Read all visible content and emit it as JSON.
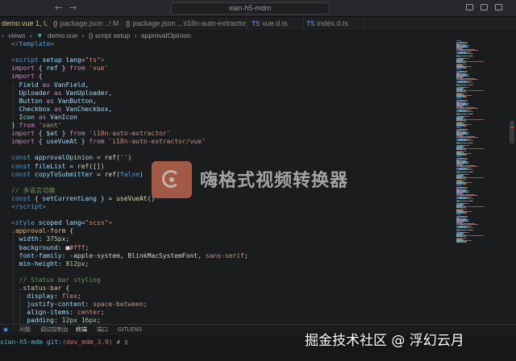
{
  "window": {
    "search_text": "xian-h5-mdm",
    "nav_back": "←",
    "nav_forward": "→"
  },
  "tabs": [
    {
      "label": "demo.vue 1, U",
      "icon": "vue-icon",
      "active": true
    },
    {
      "label": "package.json ../ M",
      "icon": "json-icon",
      "active": false
    },
    {
      "label": "package.json ...\\i18n-auto-extractor",
      "icon": "json-icon",
      "active": false
    },
    {
      "label": "vue.d.ts",
      "icon": "ts-icon",
      "active": false
    },
    {
      "label": "index.d.ts",
      "icon": "ts-icon",
      "active": false
    }
  ],
  "breadcrumb": {
    "items": [
      "views",
      "demo.vue",
      "{} script setup",
      "approvalOpinion"
    ]
  },
  "code_lines": [
    [
      [
        "tk-tag",
        "</"
      ],
      [
        "tk-tagname",
        "template"
      ],
      [
        "tk-tag",
        ">"
      ]
    ],
    [],
    [
      [
        "tk-tag",
        "<"
      ],
      [
        "tk-tagname",
        "script"
      ],
      [
        "tk-attr",
        " setup lang"
      ],
      [
        "tk-plain",
        "="
      ],
      [
        "tk-str",
        "\"ts\""
      ],
      [
        "tk-tag",
        ">"
      ]
    ],
    [
      [
        "tk-kw",
        "import"
      ],
      [
        "tk-plain",
        " { "
      ],
      [
        "tk-var",
        "ref"
      ],
      [
        "tk-plain",
        " } "
      ],
      [
        "tk-kw",
        "from"
      ],
      [
        "tk-str",
        " 'vue'"
      ]
    ],
    [
      [
        "tk-kw",
        "import"
      ],
      [
        "tk-plain",
        " {"
      ]
    ],
    [
      [
        "tk-var",
        "  Field"
      ],
      [
        "tk-kw",
        " as"
      ],
      [
        "tk-var",
        " VanField"
      ],
      [
        "tk-plain",
        ","
      ]
    ],
    [
      [
        "tk-var",
        "  Uploader"
      ],
      [
        "tk-kw",
        " as"
      ],
      [
        "tk-var",
        " VanUploader"
      ],
      [
        "tk-plain",
        ","
      ]
    ],
    [
      [
        "tk-var",
        "  Button"
      ],
      [
        "tk-kw",
        " as"
      ],
      [
        "tk-var",
        " VanButton"
      ],
      [
        "tk-plain",
        ","
      ]
    ],
    [
      [
        "tk-var",
        "  Checkbox"
      ],
      [
        "tk-kw",
        " as"
      ],
      [
        "tk-var",
        " VanCheckbox"
      ],
      [
        "tk-plain",
        ","
      ]
    ],
    [
      [
        "tk-var",
        "  Icon"
      ],
      [
        "tk-kw",
        " as"
      ],
      [
        "tk-var",
        " VanIcon"
      ]
    ],
    [
      [
        "tk-plain",
        "} "
      ],
      [
        "tk-kw",
        "from"
      ],
      [
        "tk-str",
        " 'vant'"
      ]
    ],
    [
      [
        "tk-kw",
        "import"
      ],
      [
        "tk-plain",
        " { "
      ],
      [
        "tk-var",
        "$at"
      ],
      [
        "tk-plain",
        " } "
      ],
      [
        "tk-kw",
        "from"
      ],
      [
        "tk-str",
        " 'i18n-auto-extractor'"
      ]
    ],
    [
      [
        "tk-kw",
        "import"
      ],
      [
        "tk-plain",
        " { "
      ],
      [
        "tk-var",
        "useVueAt"
      ],
      [
        "tk-plain",
        " } "
      ],
      [
        "tk-kw",
        "from"
      ],
      [
        "tk-str",
        " 'i18n-auto-extractor/vue'"
      ]
    ],
    [],
    [
      [
        "tk-kw2",
        "const"
      ],
      [
        "tk-var",
        " approvalOpinion"
      ],
      [
        "tk-plain",
        " = "
      ],
      [
        "tk-fn",
        "ref"
      ],
      [
        "tk-plain",
        "("
      ],
      [
        "tk-str",
        "''"
      ],
      [
        "tk-plain",
        ")"
      ]
    ],
    [
      [
        "tk-kw2",
        "const"
      ],
      [
        "tk-var",
        " fileList"
      ],
      [
        "tk-plain",
        " = "
      ],
      [
        "tk-fn",
        "ref"
      ],
      [
        "tk-plain",
        "([])"
      ]
    ],
    [
      [
        "tk-kw2",
        "const"
      ],
      [
        "tk-var",
        " copyToSubmitter"
      ],
      [
        "tk-plain",
        " = "
      ],
      [
        "tk-fn",
        "ref"
      ],
      [
        "tk-plain",
        "("
      ],
      [
        "tk-kw2",
        "false"
      ],
      [
        "tk-plain",
        ")"
      ]
    ],
    [],
    [
      [
        "tk-com",
        "// 多语言切换"
      ]
    ],
    [
      [
        "tk-kw2",
        "const"
      ],
      [
        "tk-plain",
        " { "
      ],
      [
        "tk-var",
        "setCurrentLang"
      ],
      [
        "tk-plain",
        " } = "
      ],
      [
        "tk-fn",
        "useVueAt"
      ],
      [
        "tk-plain",
        "()"
      ]
    ],
    [
      [
        "tk-tag",
        "</"
      ],
      [
        "tk-tagname",
        "script"
      ],
      [
        "tk-tag",
        ">"
      ]
    ],
    [],
    [
      [
        "tk-tag",
        "<"
      ],
      [
        "tk-tagname",
        "style"
      ],
      [
        "tk-attr",
        " scoped lang"
      ],
      [
        "tk-plain",
        "="
      ],
      [
        "tk-str",
        "\"scss\""
      ],
      [
        "tk-tag",
        ">"
      ]
    ],
    [
      [
        "tk-sel",
        ".approval-form"
      ],
      [
        "tk-plain",
        " {"
      ]
    ],
    [
      [
        "tk-prop",
        "  width"
      ],
      [
        "tk-plain",
        ": "
      ],
      [
        "tk-num",
        "375px"
      ],
      [
        "tk-plain",
        ";"
      ]
    ],
    [
      [
        "tk-prop",
        "  background"
      ],
      [
        "tk-plain",
        ": "
      ],
      [
        "tk-plain",
        "■"
      ],
      [
        "tk-str",
        "#fff"
      ],
      [
        "tk-plain",
        ";"
      ]
    ],
    [
      [
        "tk-prop",
        "  font-family"
      ],
      [
        "tk-plain",
        ": -apple-system, BlinkMacSystemFont, "
      ],
      [
        "tk-str",
        "sans-serif"
      ],
      [
        "tk-plain",
        ";"
      ]
    ],
    [
      [
        "tk-prop",
        "  min-height"
      ],
      [
        "tk-plain",
        ": "
      ],
      [
        "tk-num",
        "812px"
      ],
      [
        "tk-plain",
        ";"
      ]
    ],
    [],
    [
      [
        "tk-com",
        "  // Status bar styling"
      ]
    ],
    [
      [
        "tk-sel",
        "  .status-bar"
      ],
      [
        "tk-plain",
        " {"
      ]
    ],
    [
      [
        "tk-prop",
        "    display"
      ],
      [
        "tk-plain",
        ": "
      ],
      [
        "tk-str",
        "flex"
      ],
      [
        "tk-plain",
        ";"
      ]
    ],
    [
      [
        "tk-prop",
        "    justify-content"
      ],
      [
        "tk-plain",
        ": "
      ],
      [
        "tk-str",
        "space-between"
      ],
      [
        "tk-plain",
        ";"
      ]
    ],
    [
      [
        "tk-prop",
        "    align-items"
      ],
      [
        "tk-plain",
        ": "
      ],
      [
        "tk-str",
        "center"
      ],
      [
        "tk-plain",
        ";"
      ]
    ],
    [
      [
        "tk-prop",
        "    padding"
      ],
      [
        "tk-plain",
        ": "
      ],
      [
        "tk-num",
        "12px 16px"
      ],
      [
        "tk-plain",
        ";"
      ]
    ]
  ],
  "watermark": {
    "text": "嗨格式视频转换器",
    "icon": "video-converter-logo-icon"
  },
  "panel": {
    "tabs": [
      "问题",
      "调试控制台",
      "终端",
      "端口",
      "GITLENS"
    ],
    "active_tab": "终端"
  },
  "terminal": {
    "path": "xian-h5-mdm",
    "git_label": "git:",
    "branch": "(dev_mdm_3.9)",
    "marker": "✗",
    "cursor": "▯"
  },
  "overlay": {
    "text": "掘金技术社区 @ 浮幻云月"
  },
  "colors": {
    "background": "#1b1c1e",
    "active_tab_text": "#e0c060",
    "watermark_logo": "#c46a52"
  }
}
